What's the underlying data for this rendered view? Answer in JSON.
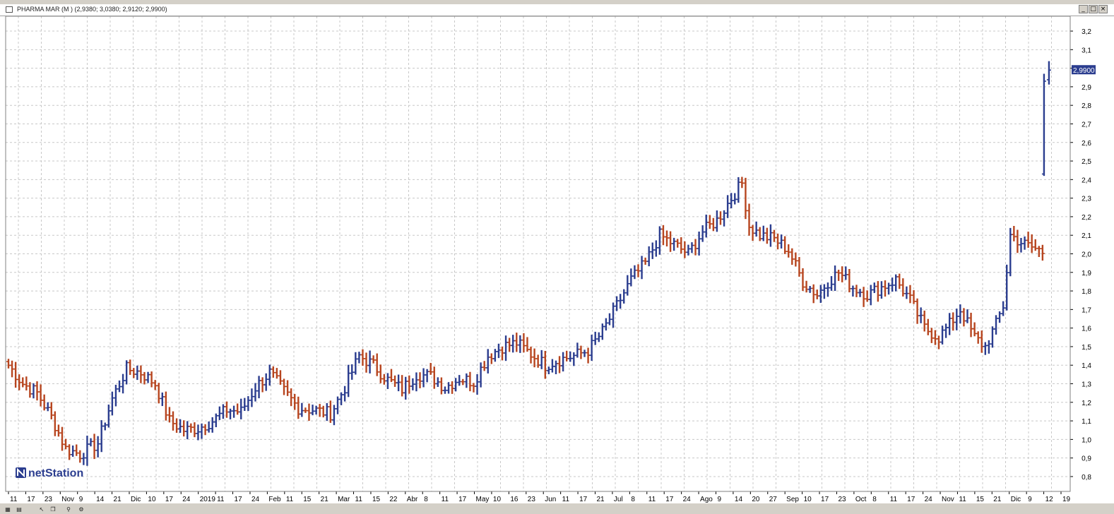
{
  "window": {
    "title": "PHARMA MAR (M ) (2,9380; 3,0380; 2,9120; 2,9900)"
  },
  "logo": {
    "text": "netStation"
  },
  "price_label": "2,9900",
  "chart_data": {
    "type": "ohlc",
    "title": "PHARMA MAR (M )",
    "last": {
      "open": 2.938,
      "high": 3.038,
      "low": 2.912,
      "close": 2.99
    },
    "ylim": [
      0.72,
      3.28
    ],
    "yticks": [
      "0,8",
      "0,9",
      "1,0",
      "1,1",
      "1,2",
      "1,3",
      "1,4",
      "1,5",
      "1,6",
      "1,7",
      "1,8",
      "1,9",
      "2,0",
      "2,1",
      "2,2",
      "2,3",
      "2,4",
      "2,5",
      "2,6",
      "2,7",
      "2,8",
      "2,9",
      "3,0",
      "3,1",
      "3,2"
    ],
    "grid": true,
    "colors": {
      "up": "#2b3d8f",
      "down": "#b7451f"
    },
    "bars_count": 290,
    "anchors": [
      [
        0,
        1.4
      ],
      [
        4,
        1.3
      ],
      [
        8,
        1.25
      ],
      [
        12,
        1.12
      ],
      [
        16,
        0.95
      ],
      [
        20,
        0.92
      ],
      [
        25,
        0.98
      ],
      [
        29,
        1.22
      ],
      [
        33,
        1.38
      ],
      [
        37,
        1.36
      ],
      [
        41,
        1.3
      ],
      [
        45,
        1.1
      ],
      [
        49,
        1.05
      ],
      [
        53,
        1.06
      ],
      [
        57,
        1.1
      ],
      [
        61,
        1.16
      ],
      [
        65,
        1.15
      ],
      [
        69,
        1.28
      ],
      [
        73,
        1.36
      ],
      [
        77,
        1.26
      ],
      [
        81,
        1.17
      ],
      [
        85,
        1.16
      ],
      [
        90,
        1.14
      ],
      [
        94,
        1.28
      ],
      [
        98,
        1.45
      ],
      [
        102,
        1.4
      ],
      [
        106,
        1.32
      ],
      [
        110,
        1.27
      ],
      [
        114,
        1.35
      ],
      [
        118,
        1.34
      ],
      [
        122,
        1.28
      ],
      [
        126,
        1.33
      ],
      [
        130,
        1.31
      ],
      [
        134,
        1.45
      ],
      [
        138,
        1.5
      ],
      [
        142,
        1.52
      ],
      [
        146,
        1.46
      ],
      [
        150,
        1.4
      ],
      [
        154,
        1.43
      ],
      [
        158,
        1.45
      ],
      [
        162,
        1.48
      ],
      [
        166,
        1.58
      ],
      [
        170,
        1.72
      ],
      [
        174,
        1.86
      ],
      [
        178,
        1.95
      ],
      [
        182,
        2.1
      ],
      [
        186,
        2.05
      ],
      [
        190,
        2.0
      ],
      [
        194,
        2.12
      ],
      [
        198,
        2.18
      ],
      [
        202,
        2.3
      ],
      [
        205,
        2.38
      ],
      [
        207,
        2.15
      ],
      [
        210,
        2.1
      ],
      [
        214,
        2.08
      ],
      [
        218,
        2.02
      ],
      [
        222,
        1.85
      ],
      [
        226,
        1.78
      ],
      [
        229,
        1.85
      ],
      [
        232,
        1.9
      ],
      [
        236,
        1.82
      ],
      [
        240,
        1.78
      ],
      [
        244,
        1.82
      ],
      [
        248,
        1.86
      ],
      [
        252,
        1.75
      ],
      [
        256,
        1.6
      ],
      [
        260,
        1.55
      ],
      [
        263,
        1.62
      ],
      [
        266,
        1.7
      ],
      [
        270,
        1.55
      ],
      [
        273,
        1.5
      ],
      [
        276,
        1.62
      ],
      [
        278,
        1.72
      ],
      [
        280,
        2.1
      ],
      [
        284,
        2.05
      ],
      [
        288,
        2.02
      ],
      [
        290,
        2.0
      ]
    ],
    "xticks": [
      "11",
      "17",
      "23",
      "Nov",
      "9",
      "14",
      "21",
      "Dic",
      "10",
      "17",
      "24",
      "2019",
      "11",
      "17",
      "24",
      "Feb",
      "11",
      "15",
      "21",
      "Mar",
      "11",
      "15",
      "22",
      "Abr",
      "8",
      "11",
      "17",
      "May",
      "10",
      "16",
      "23",
      "Jun",
      "11",
      "17",
      "21",
      "Jul",
      "8",
      "11",
      "17",
      "24",
      "Ago",
      "9",
      "14",
      "20",
      "27",
      "Sep",
      "10",
      "17",
      "23",
      "Oct",
      "8",
      "11",
      "17",
      "24",
      "Nov",
      "11",
      "15",
      "21",
      "Dic",
      "9",
      "12",
      "19"
    ]
  }
}
